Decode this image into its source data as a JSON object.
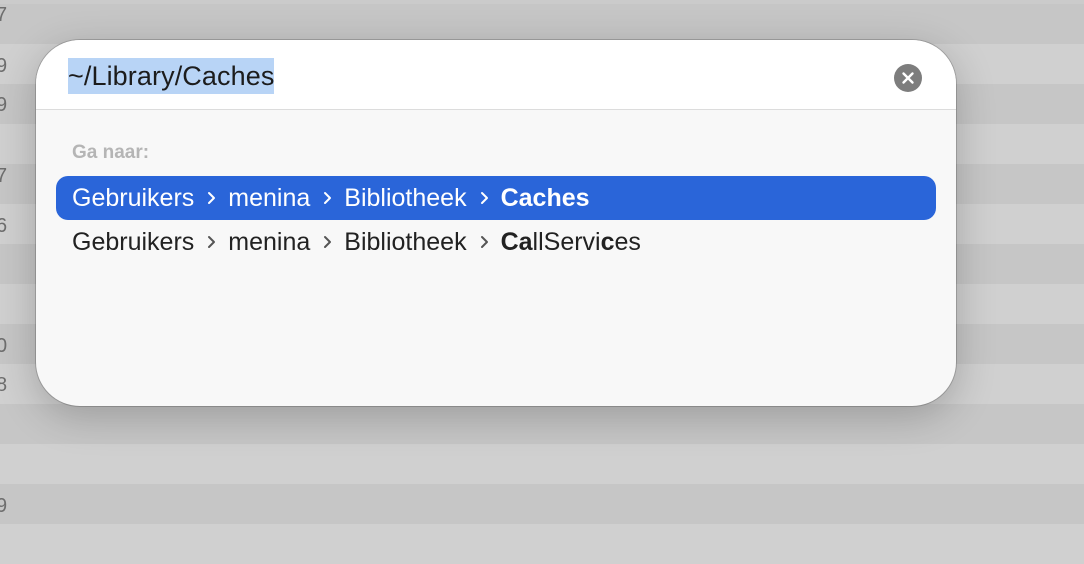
{
  "background": {
    "digits": [
      "7",
      "9",
      "9",
      "7",
      "6",
      "0",
      "8",
      "9"
    ]
  },
  "dialog": {
    "path_value": "~/Library/Caches",
    "clear_icon": "xmark-circle-icon",
    "section_label": "Ga naar:",
    "results": [
      {
        "segments": [
          "Gebruikers",
          "menina",
          "Bibliotheek"
        ],
        "final": "Caches",
        "selected": true
      },
      {
        "segments": [
          "Gebruikers",
          "menina",
          "Bibliotheek"
        ],
        "final_parts": [
          "Ca",
          "llServi",
          "c",
          "es"
        ],
        "selected": false
      }
    ]
  },
  "colors": {
    "selection": "#2a65d9",
    "text_selection": "#b8d4f6"
  }
}
